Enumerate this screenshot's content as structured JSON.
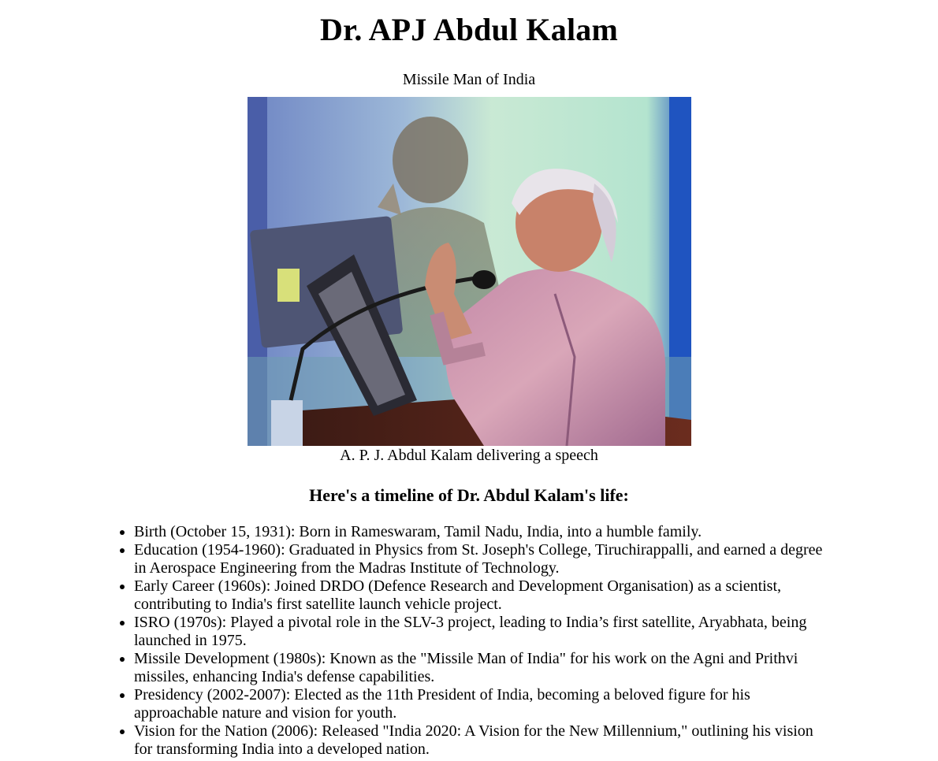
{
  "page": {
    "title": "Dr. APJ Abdul Kalam",
    "subtitle": "Missile Man of India"
  },
  "figure": {
    "caption": "A. P. J. Abdul Kalam delivering a speech"
  },
  "timeline": {
    "heading": "Here's a timeline of Dr. Abdul Kalam's life:",
    "items": [
      "Birth (October 15, 1931): Born in Rameswaram, Tamil Nadu, India, into a humble family.",
      "Education (1954-1960): Graduated in Physics from St. Joseph's College, Tiruchirappalli, and earned a degree in Aerospace Engineering from the Madras Institute of Technology.",
      "Early Career (1960s): Joined DRDO (Defence Research and Development Organisation) as a scientist, contributing to India's first satellite launch vehicle project.",
      "ISRO (1970s): Played a pivotal role in the SLV-3 project, leading to India’s first satellite, Aryabhata, being launched in 1975.",
      "Missile Development (1980s): Known as the \"Missile Man of India\" for his work on the Agni and Prithvi missiles, enhancing India's defense capabilities.",
      "Presidency (2002-2007): Elected as the 11th President of India, becoming a beloved figure for his approachable nature and vision for youth.",
      "Vision for the Nation (2006): Released \"India 2020: A Vision for the New Millennium,\" outlining his vision for transforming India into a developed nation."
    ]
  }
}
